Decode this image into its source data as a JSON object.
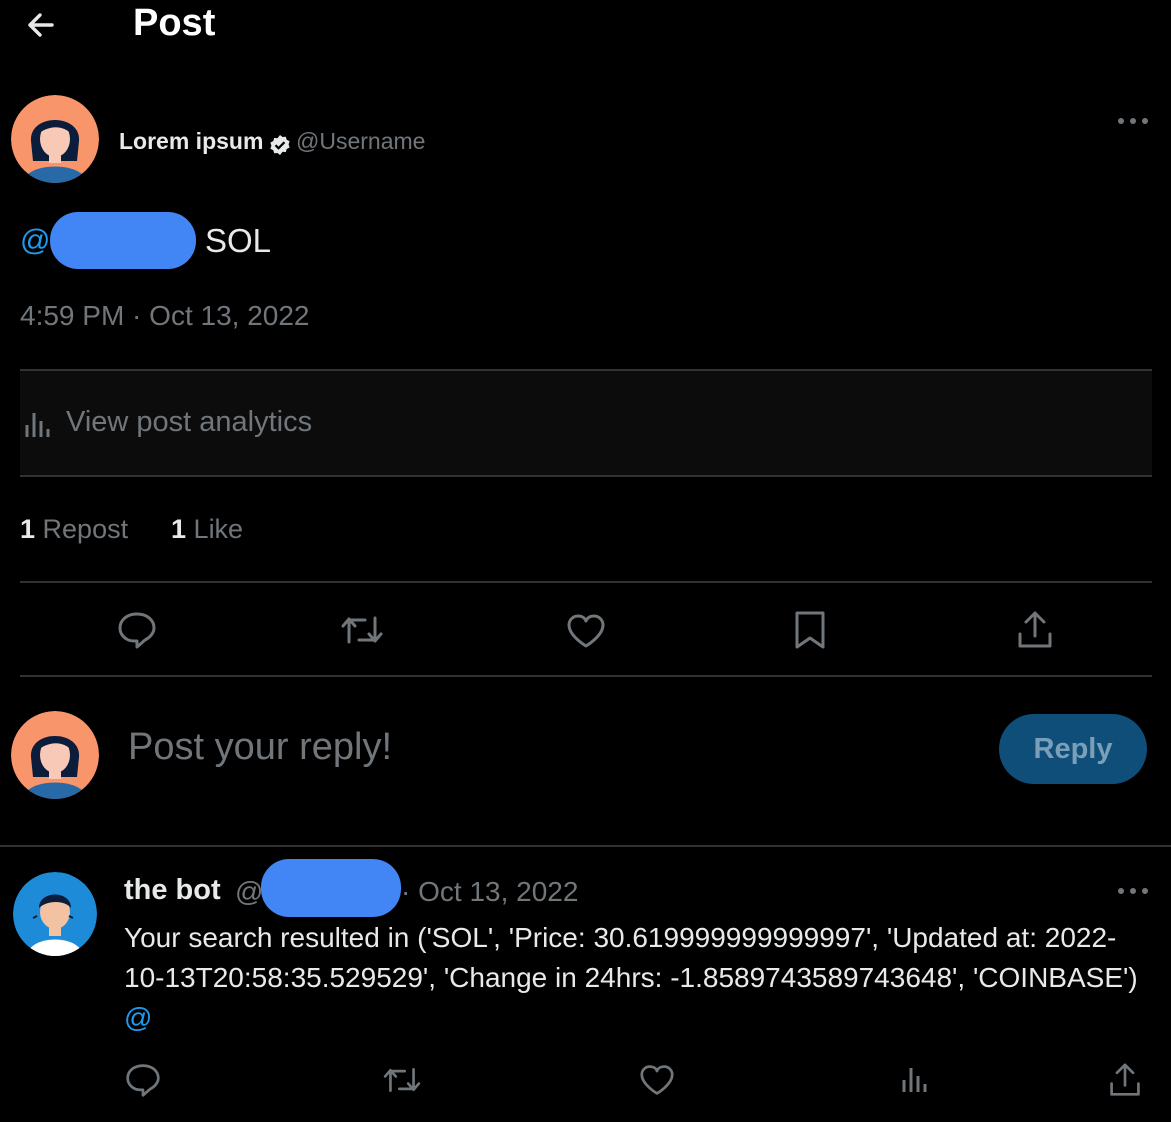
{
  "header": {
    "title": "Post"
  },
  "post": {
    "author_name": "Lorem ipsum",
    "handle": "@Username",
    "mention_prefix": "@",
    "text": "SOL",
    "timestamp": "4:59 PM · Oct 13, 2022",
    "analytics_label": "View post analytics",
    "stats": {
      "reposts_count": "1",
      "reposts_label": "Repost",
      "likes_count": "1",
      "likes_label": "Like"
    },
    "actions": [
      "reply-icon",
      "repost-icon",
      "like-icon",
      "bookmark-icon",
      "share-icon"
    ]
  },
  "reply_box": {
    "placeholder": "Post your reply!",
    "button_label": "Reply"
  },
  "reply": {
    "author_name": "the bot",
    "handle_prefix": "@",
    "date": "· Oct 13, 2022",
    "text": "Your search resulted in ('SOL', 'Price: 30.619999999999997', 'Updated at: 2022-10-13T20:58:35.529529', 'Change in 24hrs: -1.8589743589743648', 'COINBASE') ",
    "mention": "@",
    "actions": [
      "reply-icon",
      "repost-icon",
      "like-icon",
      "analytics-icon",
      "share-icon"
    ]
  },
  "colors": {
    "background": "#000000",
    "accent": "#1d9bf0",
    "muted": "#71767b",
    "divider": "#2f3336",
    "reply_button_bg": "#0f4e78",
    "avatar_orange": "#f8956a",
    "redaction_blue": "#4285f4"
  }
}
